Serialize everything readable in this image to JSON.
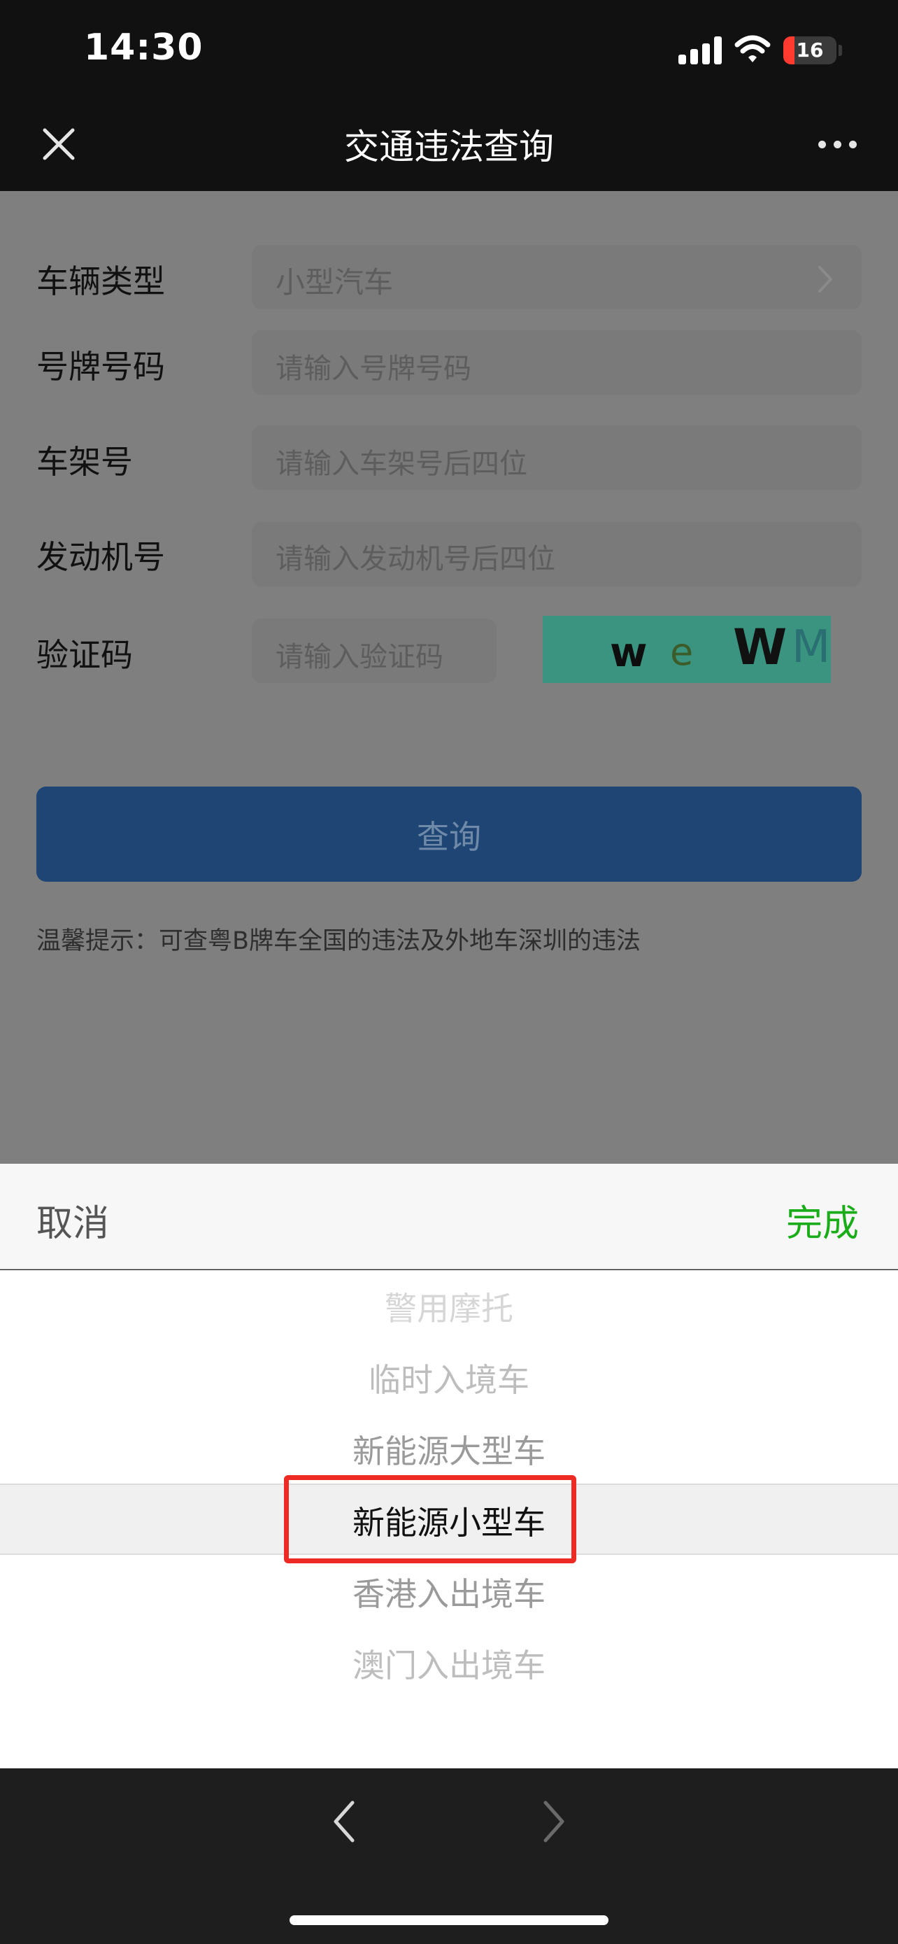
{
  "status_bar": {
    "time": "14:30",
    "battery": "16",
    "icons": [
      "signal-icon",
      "wifi-icon",
      "battery-icon"
    ]
  },
  "nav": {
    "title": "交通违法查询",
    "icons": [
      "close-icon",
      "more-icon"
    ]
  },
  "form": {
    "vehicle_type_label": "车辆类型",
    "vehicle_type_value": "小型汽车",
    "plate_label": "号牌号码",
    "plate_placeholder": "请输入号牌号码",
    "vin_label": "车架号",
    "vin_placeholder": "请输入车架号后四位",
    "engine_label": "发动机号",
    "engine_placeholder": "请输入发动机号后四位",
    "captcha_label": "验证码",
    "captcha_placeholder": "请输入验证码",
    "captcha_chars": [
      "w",
      "e",
      "W",
      "M"
    ],
    "query_button": "查询",
    "hint": "温馨提示：可查粤B牌车全国的违法及外地车深圳的违法"
  },
  "picker": {
    "cancel": "取消",
    "done": "完成",
    "options": [
      "警用摩托",
      "临时入境车",
      "新能源大型车",
      "新能源小型车",
      "香港入出境车",
      "澳门入出境车"
    ],
    "selected": "新能源小型车"
  },
  "toolbar": {
    "icons": [
      "back-arrow-icon",
      "forward-arrow-icon"
    ]
  },
  "colors": {
    "accent_done": "#1aad19",
    "query_button": "#1e4574",
    "highlight": "#ee2a24"
  }
}
